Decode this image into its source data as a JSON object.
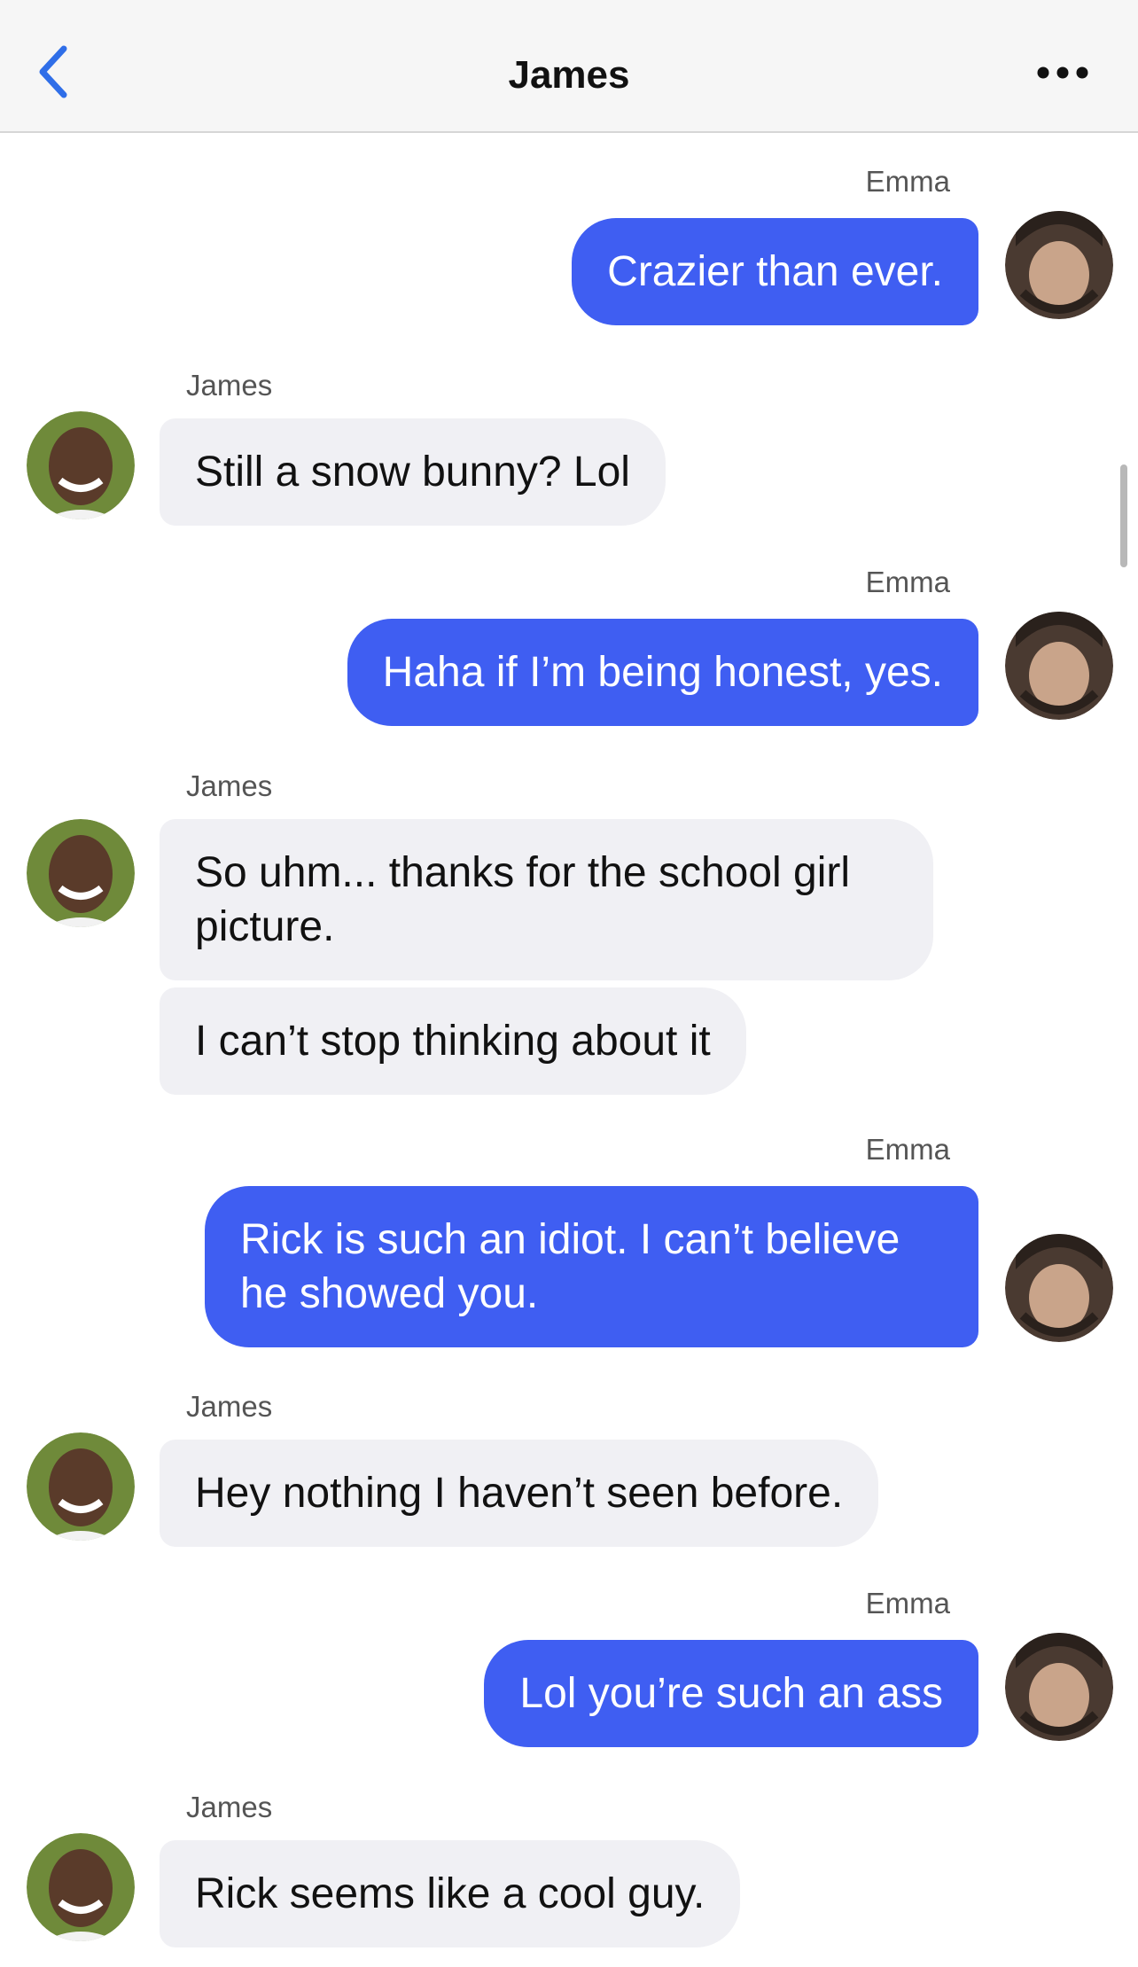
{
  "header": {
    "title": "James",
    "back_icon": "chevron-left-icon",
    "more_icon": "ellipsis-icon"
  },
  "colors": {
    "outgoing_bubble": "#3f5ef2",
    "incoming_bubble": "#f0f0f4",
    "back_icon": "#2f6ee8"
  },
  "messages": [
    {
      "sender": "Emma",
      "text": "Crazier than ever."
    },
    {
      "sender": "James",
      "text": "Still a snow bunny? Lol"
    },
    {
      "sender": "Emma",
      "text": "Haha if I’m being honest, yes."
    },
    {
      "sender": "James",
      "text": "So uhm... thanks for the school girl picture."
    },
    {
      "sender": "James",
      "text": "I can’t stop thinking about it"
    },
    {
      "sender": "Emma",
      "text": "Rick is such an idiot. I can’t believe he showed you."
    },
    {
      "sender": "James",
      "text": "Hey nothing I haven’t seen before."
    },
    {
      "sender": "Emma",
      "text": "Lol you’re such an ass"
    },
    {
      "sender": "James",
      "text": "Rick seems like a cool guy."
    }
  ]
}
